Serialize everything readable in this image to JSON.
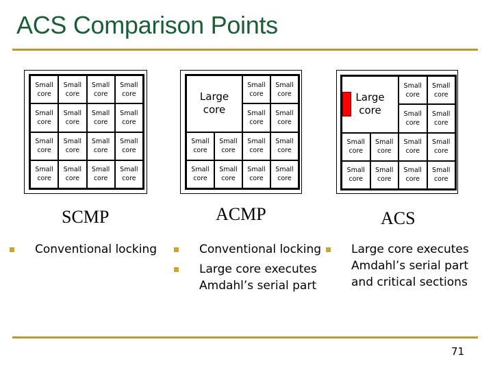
{
  "slide": {
    "title": "ACS Comparison Points",
    "page_number": "71",
    "accent_colors": {
      "title": "#1a5e36",
      "rule": "#b99a32",
      "bullet": "#c9a43a",
      "critical_section": "#ff0000"
    }
  },
  "scmp": {
    "label": "SCMP",
    "cells": [
      "Small",
      "core"
    ],
    "bullets": [
      "Conventional locking"
    ]
  },
  "acmp": {
    "label": "ACMP",
    "large_core": [
      "Large",
      "core"
    ],
    "small_core": [
      "Small",
      "core"
    ],
    "bullets": [
      "Conventional locking",
      "Large core executes Amdahl’s serial part"
    ]
  },
  "acs": {
    "label": "ACS",
    "large_core": [
      "Large",
      "core"
    ],
    "small_core": [
      "Small",
      "core"
    ],
    "bullets": [
      "Large core executes Amdahl’s serial part and critical sections"
    ]
  }
}
